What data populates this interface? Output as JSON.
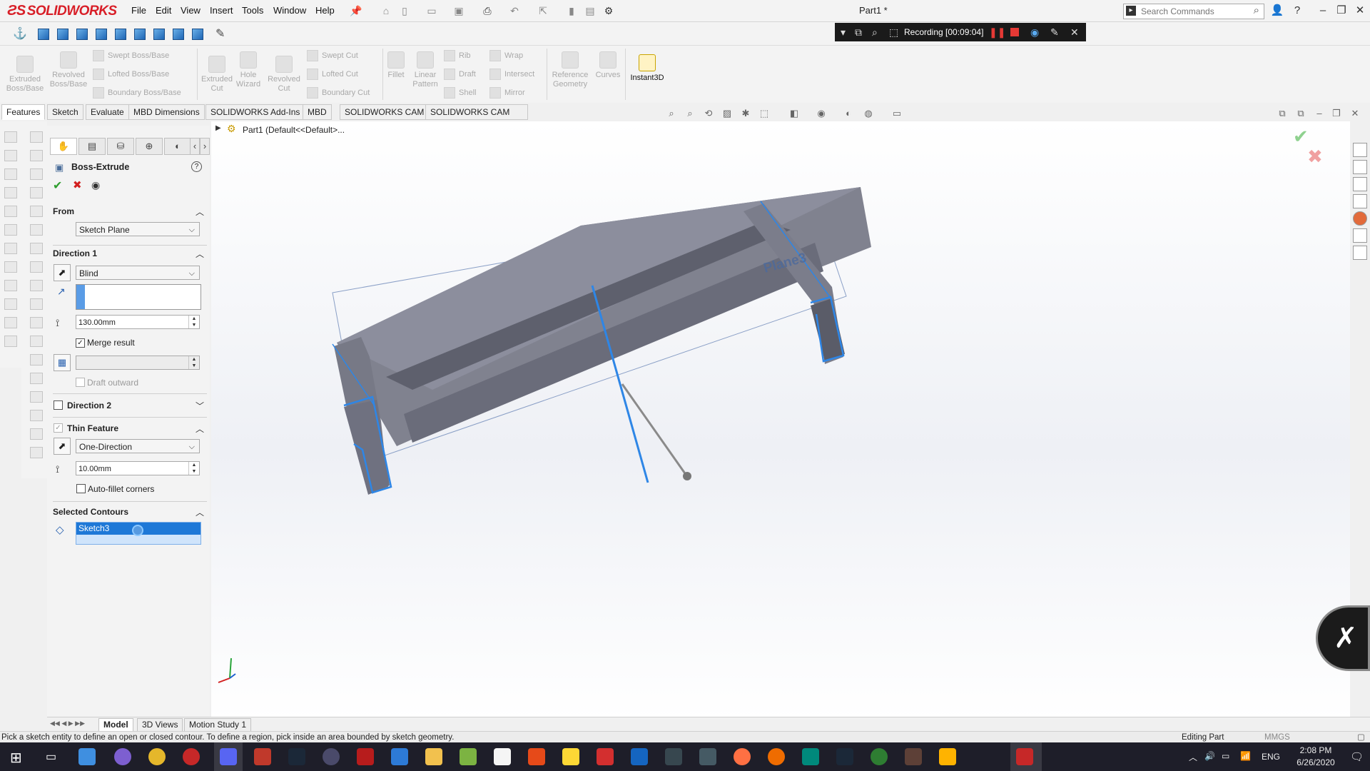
{
  "app": {
    "logo_text": "SOLIDWORKS",
    "document_title": "Part1 *",
    "menu": [
      "File",
      "Edit",
      "View",
      "Insert",
      "Tools",
      "Window",
      "Help"
    ],
    "search_placeholder": "Search Commands"
  },
  "recording": {
    "label": "Recording [00:09:04]"
  },
  "command_manager": {
    "group_features": [
      "Extruded\nBoss/Base",
      "Revolved\nBoss/Base"
    ],
    "small_boss": [
      "Swept Boss/Base",
      "Lofted Boss/Base",
      "Boundary Boss/Base"
    ],
    "group_cut": [
      "Extruded\nCut",
      "Hole\nWizard",
      "Revolved\nCut"
    ],
    "small_cut": [
      "Swept Cut",
      "Lofted Cut",
      "Boundary Cut"
    ],
    "fillet": "Fillet",
    "linear_pattern": "Linear\nPattern",
    "small_misc1": [
      "Rib",
      "Draft",
      "Shell"
    ],
    "small_misc2": [
      "Wrap",
      "Intersect",
      "Mirror"
    ],
    "ref_geom": "Reference\nGeometry",
    "curves": "Curves",
    "instant3d": "Instant3D"
  },
  "tabs": [
    "Features",
    "Sketch",
    "Evaluate",
    "MBD Dimensions",
    "SOLIDWORKS Add-Ins",
    "MBD",
    "SOLIDWORKS CAM",
    "SOLIDWORKS CAM TBM"
  ],
  "feature_tree": {
    "root": "Part1  (Default<<Default>..."
  },
  "property_manager": {
    "title": "Boss-Extrude",
    "from": {
      "heading": "From",
      "value": "Sketch Plane"
    },
    "direction1": {
      "heading": "Direction 1",
      "end_condition": "Blind",
      "depth": "130.00mm",
      "merge_result_label": "Merge result",
      "merge_result_checked": true,
      "draft_outward_label": "Draft outward"
    },
    "direction2": {
      "heading": "Direction 2"
    },
    "thin_feature": {
      "heading": "Thin Feature",
      "type": "One-Direction",
      "thickness": "10.00mm",
      "auto_fillet_label": "Auto-fillet corners"
    },
    "selected_contours": {
      "heading": "Selected Contours",
      "item": "Sketch3"
    }
  },
  "viewport": {
    "plane_label": "Plane3"
  },
  "bottom_tabs": [
    "Model",
    "3D Views",
    "Motion Study 1"
  ],
  "status": {
    "message": "Pick a sketch entity to define an open or closed contour. To define a region, pick inside an area bounded by sketch geometry.",
    "mode": "Editing Part",
    "units": "MMGS"
  },
  "taskbar": {
    "language": "ENG",
    "time": "2:08 PM",
    "date": "6/26/2020"
  },
  "colors": {
    "accent_red": "#d81e27",
    "selection_blue": "#1e78d7",
    "model_gray": "#7a7c8e"
  }
}
